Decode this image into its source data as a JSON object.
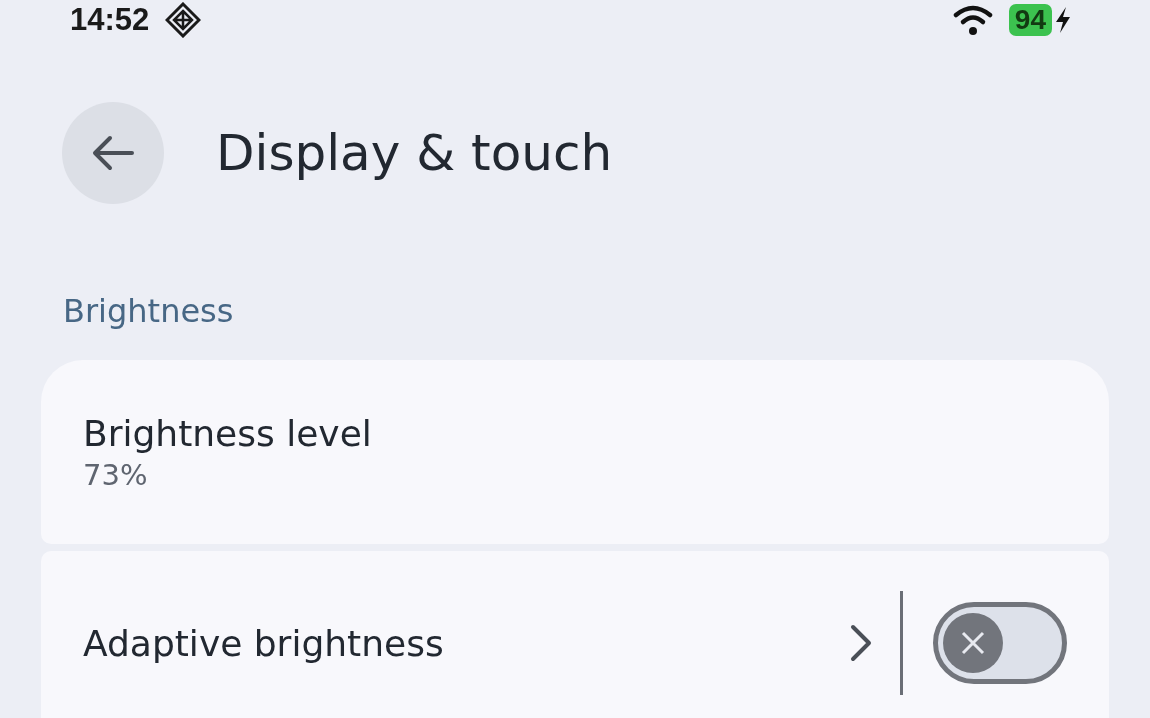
{
  "status_bar": {
    "time": "14:52",
    "battery": "94",
    "charging": true
  },
  "header": {
    "title": "Display & touch"
  },
  "section": {
    "title": "Brightness"
  },
  "items": [
    {
      "kind": "value",
      "title": "Brightness level",
      "value": "73%"
    },
    {
      "kind": "toggle",
      "title": "Adaptive brightness",
      "on": false
    }
  ]
}
